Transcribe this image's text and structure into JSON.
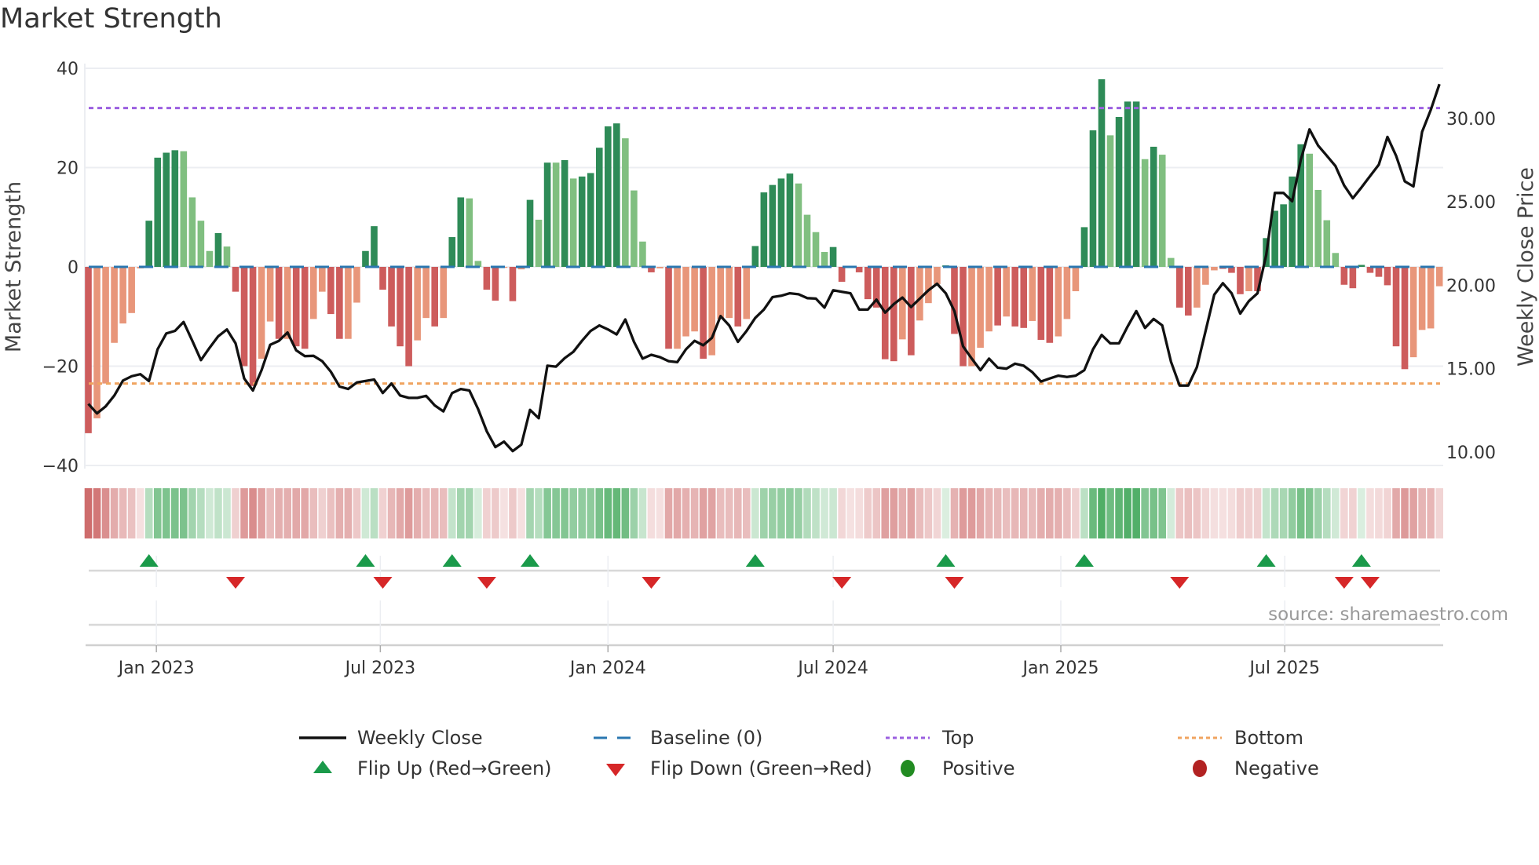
{
  "title": "Market Strength",
  "source": "source: sharemaestro.com",
  "legend": {
    "weekly_close": "Weekly Close",
    "baseline": "Baseline (0)",
    "top": "Top",
    "bottom": "Bottom",
    "flip_up": "Flip Up (Red→Green)",
    "flip_down": "Flip Down (Green→Red)",
    "positive": "Positive",
    "negative": "Negative"
  },
  "colors": {
    "strong_red": "#cd5c5c",
    "weak_red": "#e8967a",
    "strong_green": "#2e8b57",
    "weak_green": "#80bf80",
    "line": "#111111",
    "baseline": "#2a77b0",
    "top": "#9b5fe0",
    "bottom": "#f0a460",
    "flip_up": "#1a9a4a",
    "flip_down": "#d62728",
    "positive": "#228b22",
    "negative": "#b22222"
  },
  "chart_data": {
    "type": "bar",
    "title": "Market Strength",
    "ylabel": "Market Strength",
    "y2label": "Weekly Close Price",
    "ylim": [
      -40,
      40
    ],
    "y2lim": [
      9.2,
      33.0
    ],
    "yticks": [
      "40",
      "20",
      "0",
      "−20",
      "−40"
    ],
    "ytick_values": [
      40,
      20,
      0,
      -20,
      -40
    ],
    "y2ticks": [
      "30.00",
      "25.00",
      "20.00",
      "15.00",
      "10.00"
    ],
    "y2tick_values": [
      30,
      25,
      20,
      15,
      10
    ],
    "start_date": "2022-11-07",
    "interval_days": 7,
    "xticks": [
      {
        "label": "Jan 2023",
        "date": "2023-01-01"
      },
      {
        "label": "Jul 2023",
        "date": "2023-07-01"
      },
      {
        "label": "Jan 2024",
        "date": "2024-01-01"
      },
      {
        "label": "Jul 2024",
        "date": "2024-07-01"
      },
      {
        "label": "Jan 2025",
        "date": "2025-01-01"
      },
      {
        "label": "Jul 2025",
        "date": "2025-07-01"
      }
    ],
    "top_level": 32,
    "bottom_level": -23.5,
    "baseline": 0,
    "strength": [
      -33.5,
      -30.5,
      -23.5,
      -15.3,
      -11.4,
      -9.3,
      -0.3,
      9.3,
      22,
      23,
      23.5,
      23.3,
      14,
      9.3,
      3.2,
      6.8,
      4.1,
      -5,
      -20,
      -24,
      -18.5,
      -11,
      -14.5,
      -14.5,
      -16,
      -16.5,
      -10.5,
      -5,
      -9.5,
      -14.5,
      -14.5,
      -7.2,
      3.2,
      8.2,
      -4.6,
      -12,
      -16,
      -20,
      -14.8,
      -10.3,
      -12,
      -10.3,
      6,
      14,
      13.8,
      1.2,
      -4.6,
      -6.8,
      -0.2,
      -6.9,
      -0.5,
      13.5,
      9.5,
      21,
      21,
      21.5,
      17.8,
      18.2,
      18.9,
      24,
      28.3,
      28.9,
      25.9,
      15.4,
      5.1,
      -1.1,
      -0.3,
      -16.5,
      -16.5,
      -14,
      -13,
      -18.5,
      -17.8,
      -10.5,
      -10.3,
      -12,
      -10.5,
      4.2,
      15,
      16.5,
      17.8,
      18.8,
      16.8,
      10.5,
      7,
      3,
      4,
      -3,
      -0.2,
      -1.1,
      -6.5,
      -8.2,
      -18.6,
      -19,
      -14.6,
      -17.8,
      -10.8,
      -7.3,
      -3.5,
      0.3,
      -13.5,
      -20,
      -20,
      -16.3,
      -13,
      -11.8,
      -10,
      -12,
      -12.3,
      -10.9,
      -14.7,
      -15.3,
      -14,
      -10.5,
      -4.9,
      8,
      27.5,
      37.8,
      26.5,
      30.2,
      33.3,
      33.3,
      21.7,
      24.2,
      22.6,
      1.8,
      -8.2,
      -9.8,
      -8.2,
      -3.6,
      -0.7,
      -0.4,
      -1.2,
      -5.5,
      -4.9,
      -4.9,
      5.8,
      11.3,
      12.6,
      18.2,
      24.7,
      22.8,
      15.5,
      9.4,
      2.8,
      -3.6,
      -4.3,
      0.4,
      -1.2,
      -2,
      -3.7,
      -16,
      -20.6,
      -18.2,
      -12.7,
      -12.4,
      -3.9
    ],
    "shade": "dllllllddddlllldlddd lldlddlldd llddddddll dlddllddld ldldldlddd ddllldldll ldllldlddd ddllllddld ddddldllld ddllldlddl ddllldddld ddldllddll ldddlddddd dllllddddd dddllll",
    "weekly_close": [
      12.89,
      12.32,
      12.74,
      13.39,
      14.29,
      14.55,
      14.67,
      14.26,
      16.16,
      17.11,
      17.26,
      17.8,
      16.67,
      15.51,
      16.25,
      16.94,
      17.35,
      16.52,
      14.41,
      13.69,
      14.91,
      16.43,
      16.67,
      17.17,
      16.1,
      15.75,
      15.77,
      15.45,
      14.82,
      13.93,
      13.78,
      14.17,
      14.26,
      14.35,
      13.54,
      14.11,
      13.39,
      13.25,
      13.25,
      13.37,
      12.8,
      12.44,
      13.54,
      13.78,
      13.69,
      12.59,
      11.25,
      10.3,
      10.63,
      10.06,
      10.45,
      12.53,
      12.03,
      15.18,
      15.12,
      15.63,
      16.01,
      16.67,
      17.26,
      17.59,
      17.35,
      17.05,
      17.95,
      16.61,
      15.6,
      15.83,
      15.69,
      15.45,
      15.39,
      16.16,
      16.67,
      16.4,
      16.85,
      18.15,
      17.59,
      16.61,
      17.26,
      18.04,
      18.54,
      19.29,
      19.37,
      19.52,
      19.46,
      19.23,
      19.2,
      18.66,
      19.7,
      19.61,
      19.52,
      18.54,
      18.54,
      19.14,
      18.36,
      18.87,
      19.26,
      18.69,
      19.2,
      19.7,
      20.09,
      19.52,
      18.45,
      16.34,
      15.6,
      14.91,
      15.6,
      15.06,
      15.0,
      15.3,
      15.18,
      14.79,
      14.23,
      14.41,
      14.58,
      14.5,
      14.58,
      14.91,
      16.16,
      17.02,
      16.52,
      16.52,
      17.53,
      18.45,
      17.44,
      17.98,
      17.59,
      15.42,
      13.99,
      13.99,
      15.09,
      17.26,
      19.43,
      20.12,
      19.52,
      18.3,
      19.05,
      19.52,
      21.81,
      25.53,
      25.53,
      25.03,
      27.53,
      29.34,
      28.36,
      27.76,
      27.14,
      25.98,
      25.21,
      25.86,
      26.54,
      27.23,
      28.89,
      27.76,
      26.22,
      25.92,
      29.19,
      30.5,
      32.05
    ],
    "flip_up_weeks": [
      7,
      32,
      42,
      51,
      77,
      99,
      115,
      136,
      147
    ],
    "flip_down_weeks": [
      17,
      34,
      46,
      65,
      87,
      100,
      126,
      145,
      148
    ]
  }
}
